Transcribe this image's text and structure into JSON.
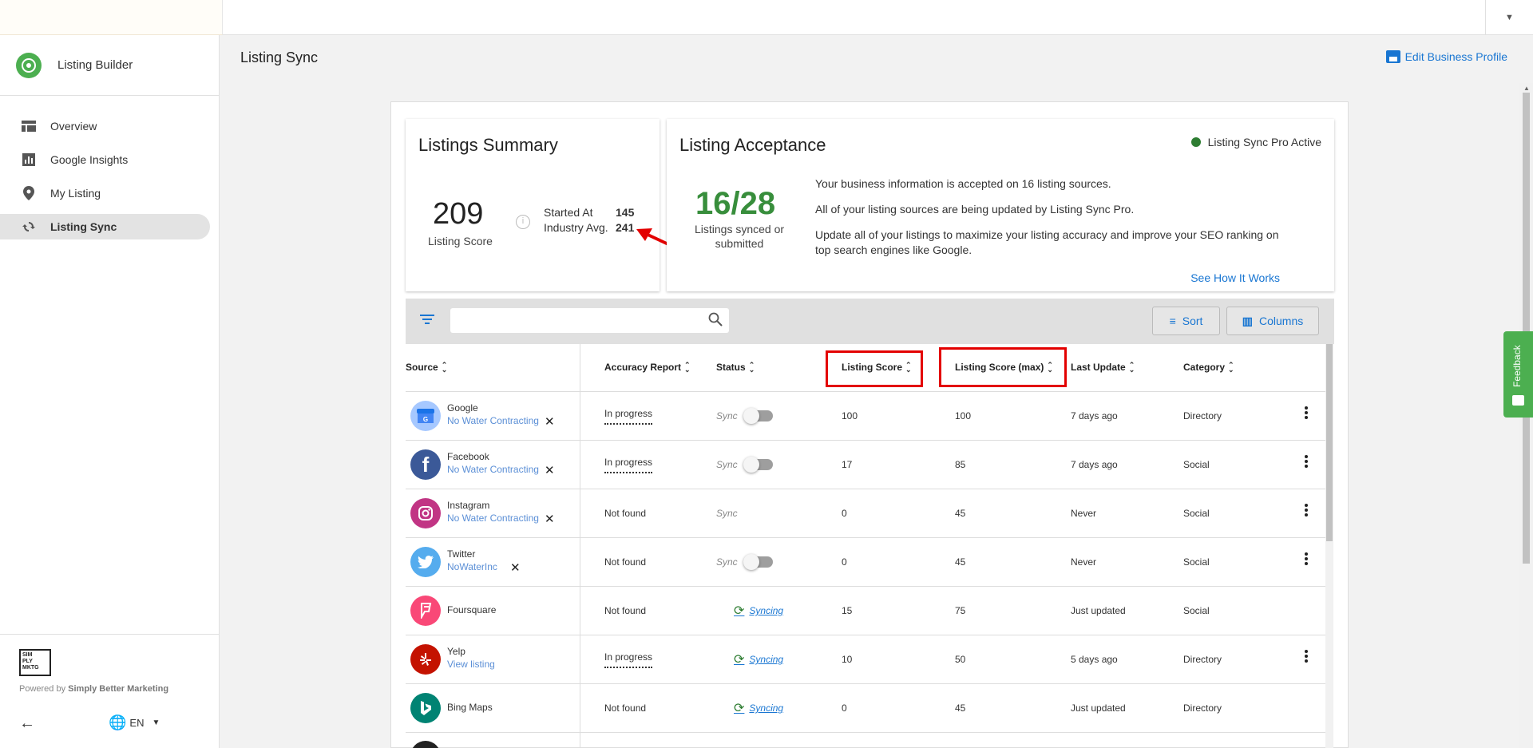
{
  "app": {
    "brand_title": "Listing Builder",
    "page_title": "Listing Sync",
    "edit_profile": "Edit Business Profile"
  },
  "sidebar": {
    "items": [
      {
        "label": "Overview",
        "icon": "dashboard-icon"
      },
      {
        "label": "Google Insights",
        "icon": "bar-chart-icon"
      },
      {
        "label": "My Listing",
        "icon": "location-pin-icon"
      },
      {
        "label": "Listing Sync",
        "icon": "sync-icon",
        "active": true
      }
    ],
    "footer": {
      "logo_text": "SIMPLY BETTER MKTG",
      "powered_prefix": "Powered by",
      "powered_by": "Simply Better Marketing",
      "language": "EN"
    }
  },
  "summary": {
    "title": "Listings Summary",
    "score": "209",
    "score_label": "Listing Score",
    "started_label": "Started At",
    "started_value": "145",
    "industry_label": "Industry Avg.",
    "industry_value": "241"
  },
  "acceptance": {
    "title": "Listing Acceptance",
    "status": "Listing Sync Pro Active",
    "fraction": "16/28",
    "fraction_label": "Listings synced or submitted",
    "line1": "Your business information is accepted on 16 listing sources.",
    "line2": "All of your listing sources are being updated by Listing Sync Pro.",
    "line3": "Update all of your listings to maximize your listing accuracy and improve your SEO ranking on top search engines like Google.",
    "link": "See How It Works"
  },
  "toolbar": {
    "search_placeholder": "",
    "sort_label": "Sort",
    "columns_label": "Columns"
  },
  "table": {
    "headers": {
      "source": "Source",
      "accuracy": "Accuracy Report",
      "status": "Status",
      "score": "Listing Score",
      "max": "Listing Score (max)",
      "last": "Last Update",
      "category": "Category"
    },
    "rows": [
      {
        "name": "Google",
        "link": "No Water Contracting",
        "accuracy": "In progress",
        "sync": "Sync",
        "syncing": "",
        "score": "100",
        "max": "100",
        "last": "7 days ago",
        "category": "Directory"
      },
      {
        "name": "Facebook",
        "link": "No Water Contracting",
        "accuracy": "In progress",
        "sync": "Sync",
        "syncing": "",
        "score": "17",
        "max": "85",
        "last": "7 days ago",
        "category": "Social"
      },
      {
        "name": "Instagram",
        "link": "No Water Contracting",
        "accuracy": "Not found",
        "sync": "Sync",
        "syncing": "",
        "score": "0",
        "max": "45",
        "last": "Never",
        "category": "Social"
      },
      {
        "name": "Twitter",
        "link": "NoWaterInc",
        "accuracy": "Not found",
        "sync": "Sync",
        "syncing": "",
        "score": "0",
        "max": "45",
        "last": "Never",
        "category": "Social"
      },
      {
        "name": "Foursquare",
        "link": "",
        "accuracy": "Not found",
        "sync": "",
        "syncing": "Syncing",
        "score": "15",
        "max": "75",
        "last": "Just updated",
        "category": "Social"
      },
      {
        "name": "Yelp",
        "link": "View listing",
        "accuracy": "In progress",
        "sync": "",
        "syncing": "Syncing",
        "score": "10",
        "max": "50",
        "last": "5 days ago",
        "category": "Directory"
      },
      {
        "name": "Bing Maps",
        "link": "",
        "accuracy": "Not found",
        "sync": "",
        "syncing": "Syncing",
        "score": "0",
        "max": "45",
        "last": "Just updated",
        "category": "Directory"
      }
    ]
  },
  "feedback": "Feedback",
  "colors": {
    "accent": "#1976d2",
    "success": "#388e3c",
    "highlight": "#e30000",
    "google": "#a6c8ff",
    "facebook": "#3b5998",
    "instagram": "#c13584",
    "twitter": "#55acee",
    "foursquare": "#f94877",
    "yelp": "#c41200",
    "bing": "#008373"
  }
}
